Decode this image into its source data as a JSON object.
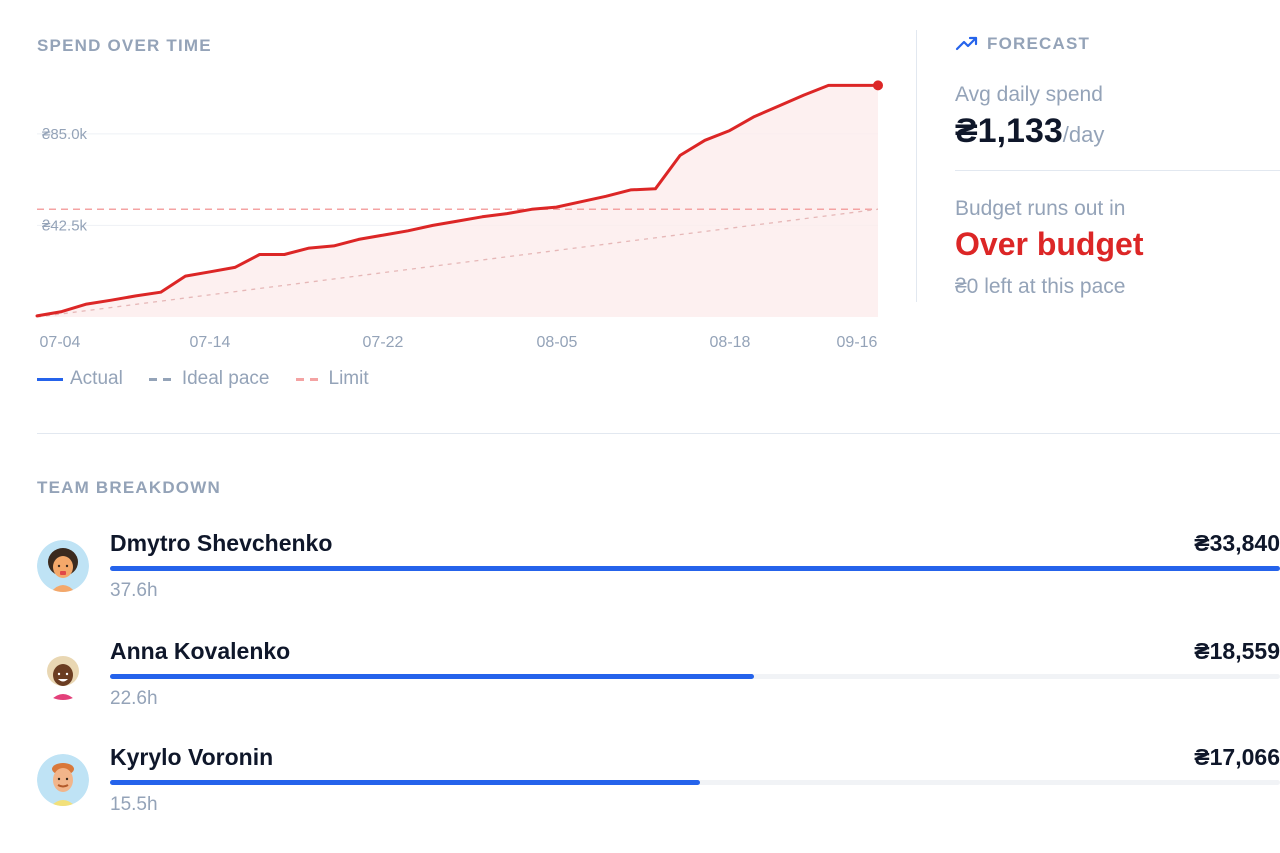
{
  "spend_section": {
    "title": "SPEND OVER TIME"
  },
  "chart_data": {
    "type": "area",
    "currency_symbol": "₴",
    "x_tick_labels": [
      "07-04",
      "07-14",
      "07-22",
      "08-05",
      "08-18",
      "09-16"
    ],
    "y_tick_labels": [
      "₴85.0k",
      "₴42.5k"
    ],
    "y_ticks": [
      85000,
      42500
    ],
    "ylim": [
      0,
      110000
    ],
    "series": [
      {
        "name": "Actual",
        "color": "#dc2626",
        "values": [
          500,
          2500,
          6000,
          7800,
          9800,
          11500,
          19000,
          21000,
          23000,
          29000,
          29000,
          32000,
          33000,
          36000,
          38000,
          40000,
          42500,
          44500,
          46500,
          48000,
          50000,
          51000,
          53500,
          56000,
          59000,
          59500,
          75000,
          82000,
          86500,
          93000,
          98000,
          103000,
          107500,
          107500,
          107500
        ]
      }
    ],
    "ideal_pace": {
      "name": "Ideal pace",
      "start": 0,
      "end": 50000
    },
    "limit": {
      "name": "Limit",
      "value": 50000,
      "color": "#f4a3a3"
    },
    "grid": true,
    "legend_position": "bottom-left"
  },
  "legend": {
    "actual": "Actual",
    "ideal": "Ideal pace",
    "limit": "Limit"
  },
  "forecast": {
    "title": "FORECAST",
    "icon": "trending-up-icon",
    "avg_label": "Avg daily spend",
    "avg_value": "₴1,133",
    "avg_unit": "/day",
    "runout_label": "Budget runs out in",
    "runout_value": "Over budget",
    "left_note": "₴0 left at this pace"
  },
  "team": {
    "title": "TEAM BREAKDOWN",
    "members": [
      {
        "name": "Dmytro Shevchenko",
        "amount": "₴33,840",
        "hours": "37.6h",
        "share": 1.0
      },
      {
        "name": "Anna Kovalenko",
        "amount": "₴18,559",
        "hours": "22.6h",
        "share": 0.55
      },
      {
        "name": "Kyrylo Voronin",
        "amount": "₴17,066",
        "hours": "15.5h",
        "share": 0.504
      }
    ]
  },
  "colors": {
    "accent": "#2563eb",
    "danger": "#dc2626",
    "muted": "#94a3b8"
  }
}
